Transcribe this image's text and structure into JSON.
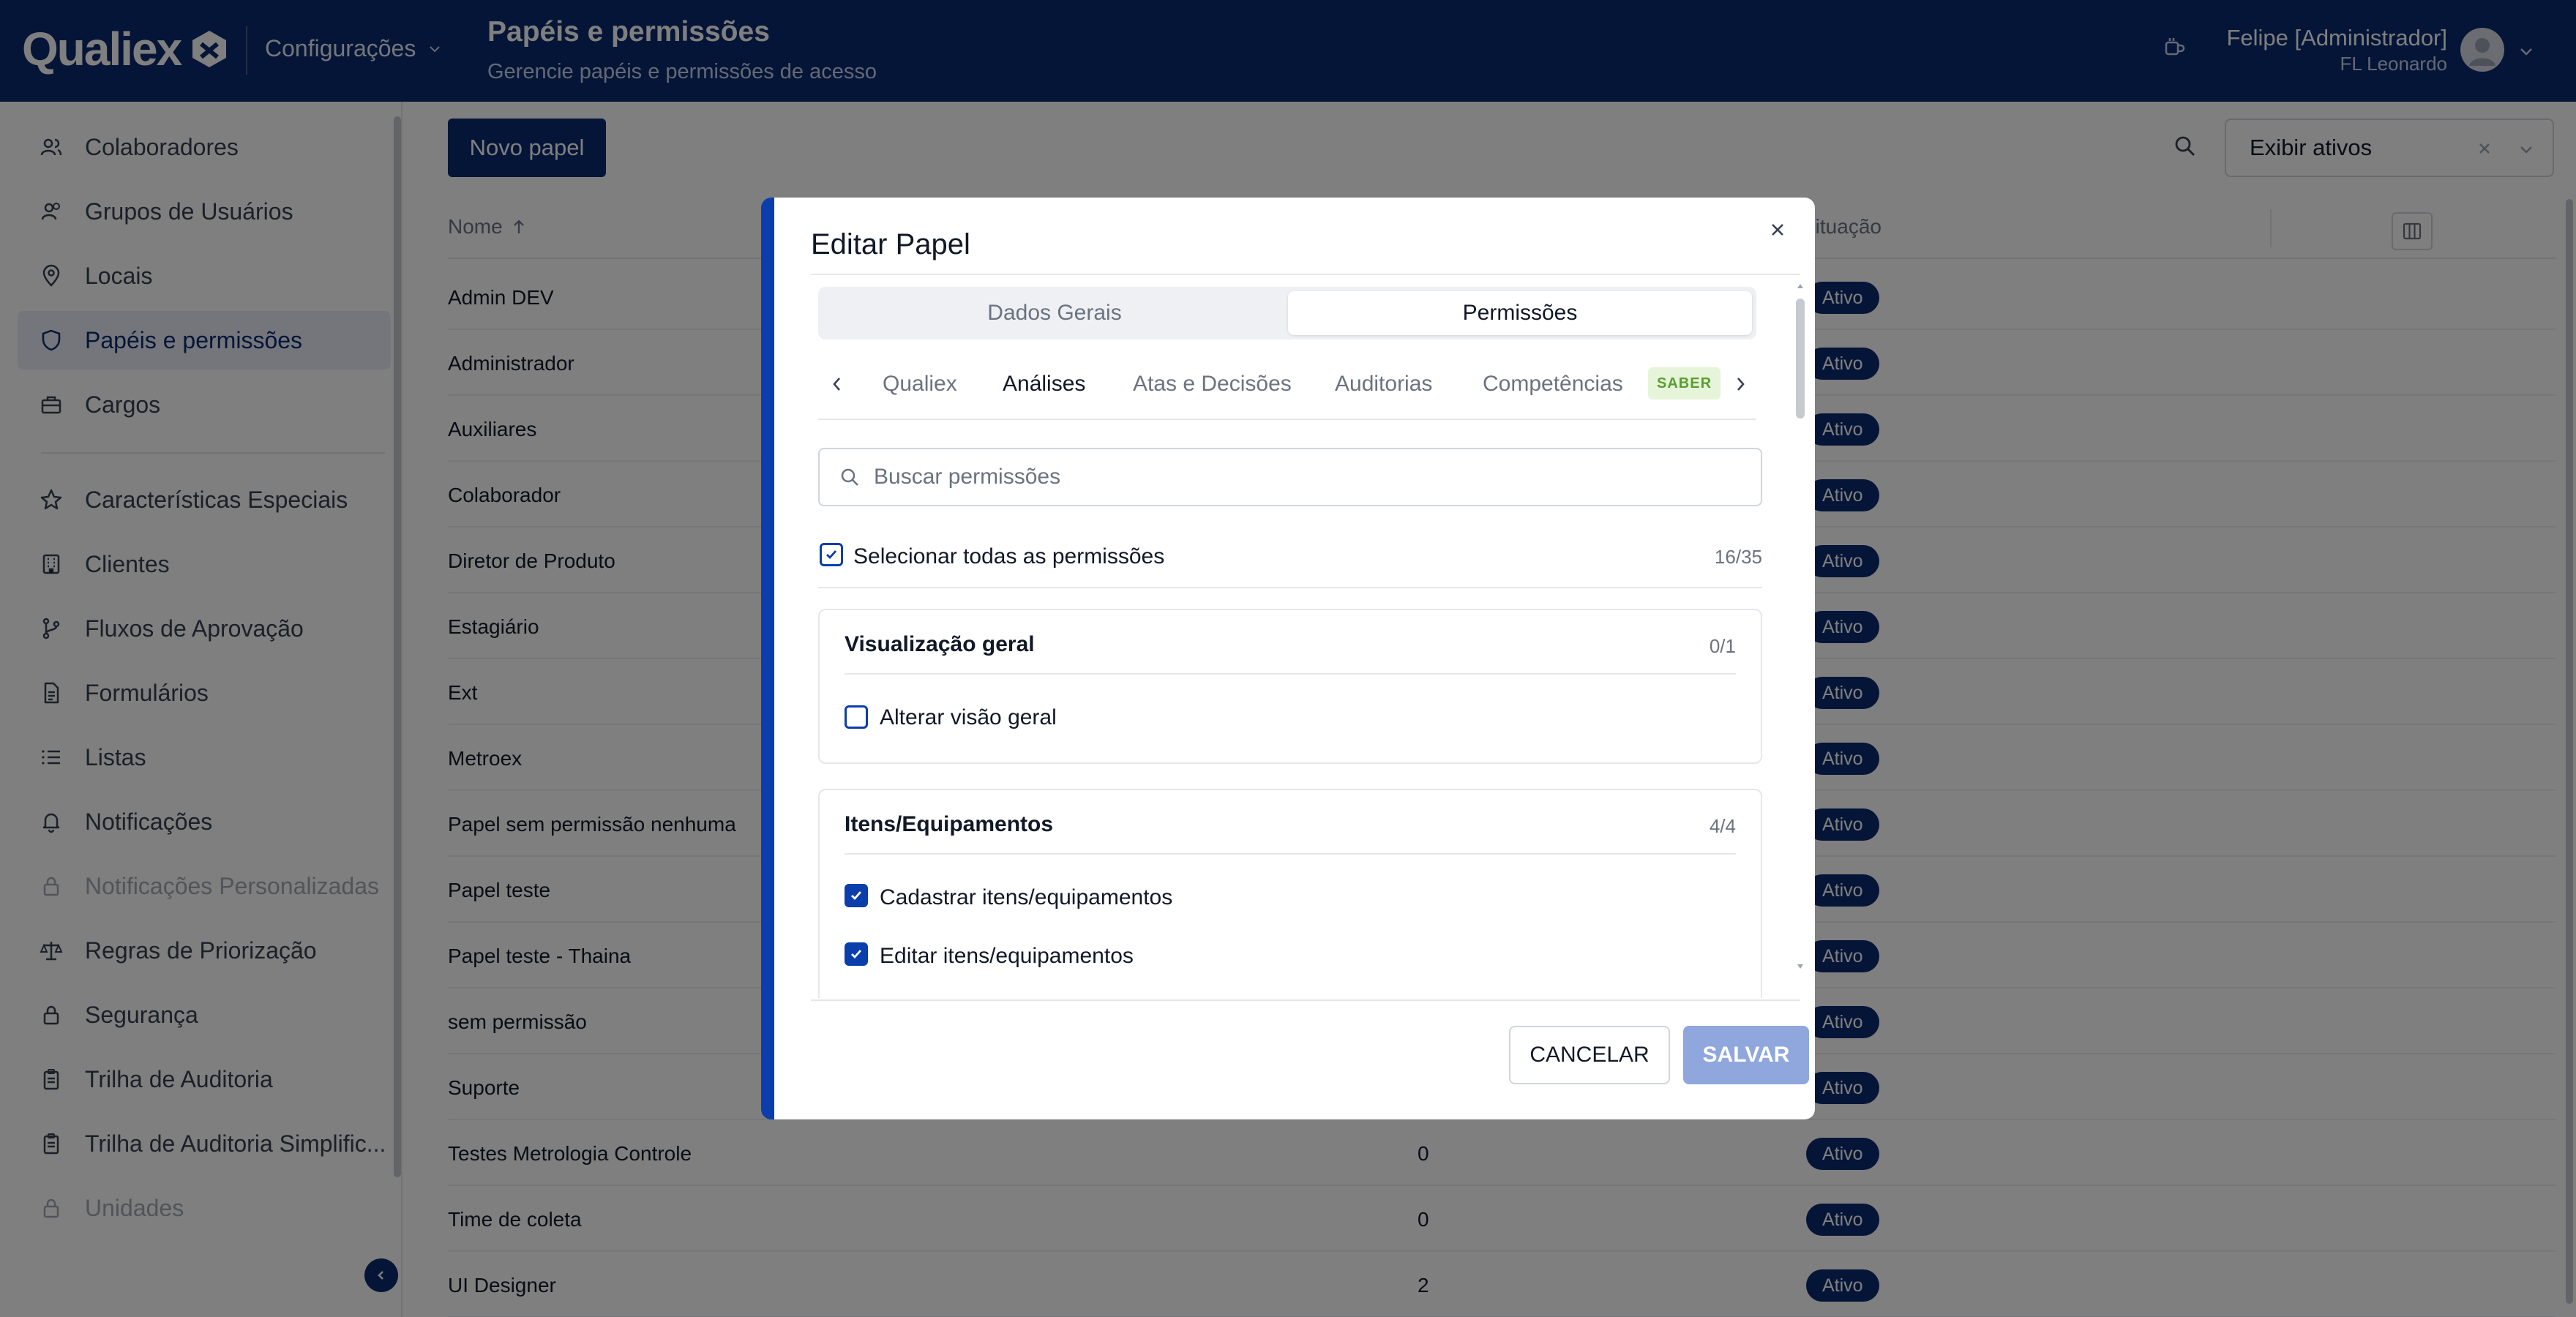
{
  "header": {
    "logo_text": "Qualiex",
    "config_menu_label": "Configurações",
    "title": "Papéis e permissões",
    "subtitle": "Gerencie papéis e permissões de acesso",
    "user_name": "Felipe [Administrador]",
    "user_org": "FL Leonardo"
  },
  "sidebar": {
    "items": [
      {
        "label": "Colaboradores",
        "icon": "users-icon",
        "state": "normal"
      },
      {
        "label": "Grupos de Usuários",
        "icon": "user-group-icon",
        "state": "normal"
      },
      {
        "label": "Locais",
        "icon": "map-pin-icon",
        "state": "normal"
      },
      {
        "label": "Papéis e permissões",
        "icon": "shield-icon",
        "state": "active"
      },
      {
        "label": "Cargos",
        "icon": "briefcase-icon",
        "state": "normal"
      },
      {
        "label": "Características Especiais",
        "icon": "star-icon",
        "state": "normal"
      },
      {
        "label": "Clientes",
        "icon": "building-icon",
        "state": "normal"
      },
      {
        "label": "Fluxos de Aprovação",
        "icon": "git-branch-icon",
        "state": "normal"
      },
      {
        "label": "Formulários",
        "icon": "file-icon",
        "state": "normal"
      },
      {
        "label": "Listas",
        "icon": "list-icon",
        "state": "normal"
      },
      {
        "label": "Notificações",
        "icon": "bell-icon",
        "state": "normal"
      },
      {
        "label": "Notificações Personalizadas",
        "icon": "lock-icon",
        "state": "disabled"
      },
      {
        "label": "Regras de Priorização",
        "icon": "scale-icon",
        "state": "normal"
      },
      {
        "label": "Segurança",
        "icon": "lock-icon",
        "state": "normal"
      },
      {
        "label": "Trilha de Auditoria",
        "icon": "clipboard-icon",
        "state": "normal"
      },
      {
        "label": "Trilha de Auditoria Simplific...",
        "icon": "clipboard-icon",
        "state": "normal"
      },
      {
        "label": "Unidades",
        "icon": "lock-icon",
        "state": "disabled"
      }
    ]
  },
  "main": {
    "new_role_label": "Novo papel",
    "filter_value": "Exibir ativos",
    "columns": {
      "name": "Nome",
      "status": "Situação"
    },
    "rows": [
      {
        "name": "Admin DEV",
        "users": "",
        "status": "Ativo"
      },
      {
        "name": "Administrador",
        "users": "",
        "status": "Ativo"
      },
      {
        "name": "Auxiliares",
        "users": "",
        "status": "Ativo"
      },
      {
        "name": "Colaborador",
        "users": "",
        "status": "Ativo"
      },
      {
        "name": "Diretor de Produto",
        "users": "",
        "status": "Ativo"
      },
      {
        "name": "Estagiário",
        "users": "",
        "status": "Ativo"
      },
      {
        "name": "Ext",
        "users": "",
        "status": "Ativo"
      },
      {
        "name": "Metroex",
        "users": "",
        "status": "Ativo"
      },
      {
        "name": "Papel sem permissão nenhuma",
        "users": "",
        "status": "Ativo"
      },
      {
        "name": "Papel teste",
        "users": "",
        "status": "Ativo"
      },
      {
        "name": "Papel teste - Thaina",
        "users": "",
        "status": "Ativo"
      },
      {
        "name": "sem permissão",
        "users": "",
        "status": "Ativo"
      },
      {
        "name": "Suporte",
        "users": "",
        "status": "Ativo"
      },
      {
        "name": "Testes Metrologia Controle",
        "users": "0",
        "status": "Ativo"
      },
      {
        "name": "Time de coleta",
        "users": "0",
        "status": "Ativo"
      },
      {
        "name": "UI Designer",
        "users": "2",
        "status": "Ativo"
      }
    ]
  },
  "modal": {
    "title": "Editar Papel",
    "segments": [
      {
        "label": "Dados Gerais",
        "active": false
      },
      {
        "label": "Permissões",
        "active": true
      }
    ],
    "tabs": [
      {
        "label": "Qualiex",
        "active": false
      },
      {
        "label": "Análises",
        "active": true
      },
      {
        "label": "Atas e Decisões",
        "active": false
      },
      {
        "label": "Auditorias",
        "active": false
      },
      {
        "label": "Competências",
        "active": false,
        "badge": "SABER"
      }
    ],
    "search_placeholder": "Buscar permissões",
    "select_all_label": "Selecionar todas as permissões",
    "select_all_count": "16/35",
    "groups": [
      {
        "title": "Visualização geral",
        "count": "0/1",
        "permissions": [
          {
            "label": "Alterar visão geral",
            "checked": false
          }
        ]
      },
      {
        "title": "Itens/Equipamentos",
        "count": "4/4",
        "permissions": [
          {
            "label": "Cadastrar itens/equipamentos",
            "checked": true
          },
          {
            "label": "Editar itens/equipamentos",
            "checked": true
          }
        ]
      }
    ],
    "cancel_label": "CANCELAR",
    "save_label": "SALVAR"
  },
  "colors": {
    "primary": "#0b2a6f",
    "modal_accent": "#0b3ead",
    "badge_green_bg": "#e6f5d9",
    "save_disabled": "#8fa7dd"
  }
}
